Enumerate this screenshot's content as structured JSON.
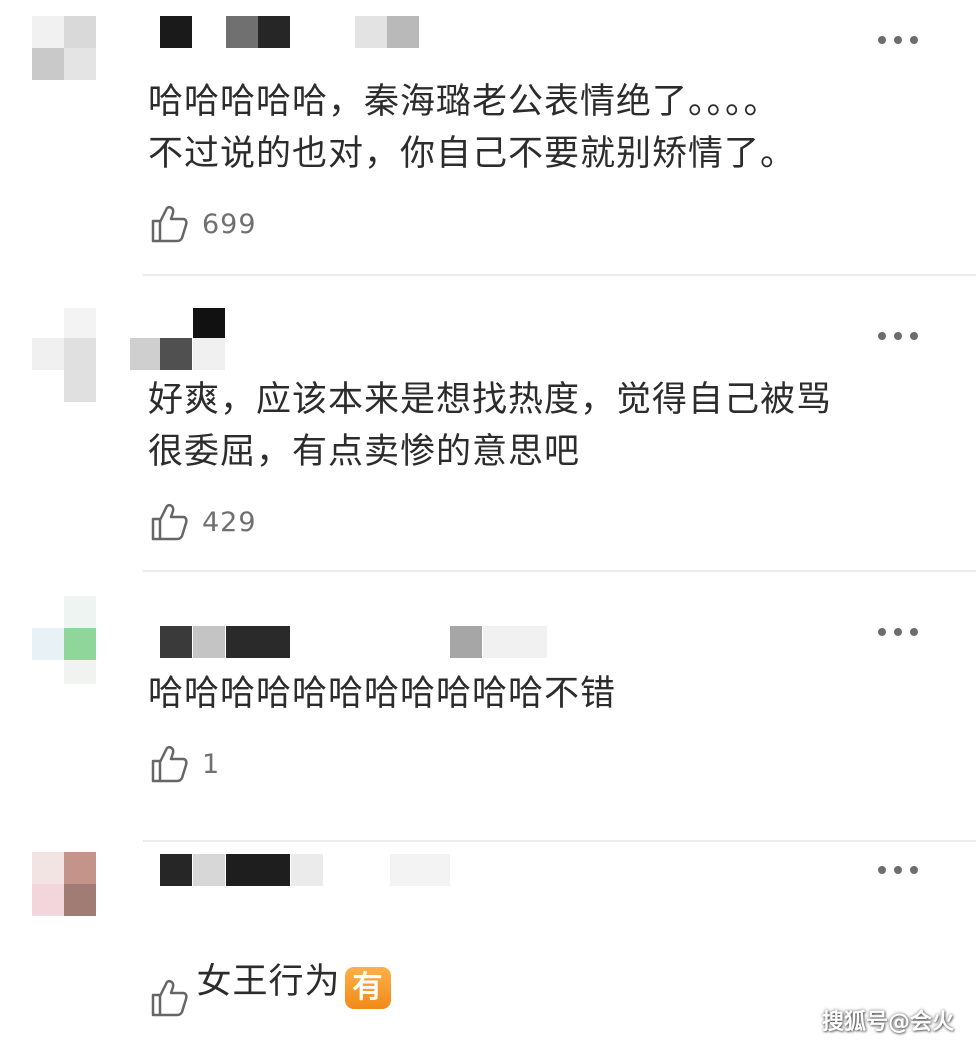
{
  "comments": [
    {
      "text": "哈哈哈哈哈，秦海璐老公表情绝了。。。。\n不过说的也对，你自己不要就别矫情了。",
      "likes": "699",
      "badge": ""
    },
    {
      "text": "好爽，应该本来是想找热度，觉得自己被骂\n很委屈，有点卖惨的意思吧",
      "likes": "429",
      "badge": ""
    },
    {
      "text": "哈哈哈哈哈哈哈哈哈哈哈不错",
      "likes": "1",
      "badge": ""
    },
    {
      "text": "女王行为",
      "likes": "",
      "badge": "有"
    }
  ],
  "icons": {
    "like": "thumbs-up-icon",
    "more": "more-dots-icon"
  },
  "watermark": "搜狐号@会火",
  "colors": {
    "text": "#2c2c2c",
    "muted": "#707070",
    "divider": "#ececec",
    "badge": "#f39a26"
  }
}
